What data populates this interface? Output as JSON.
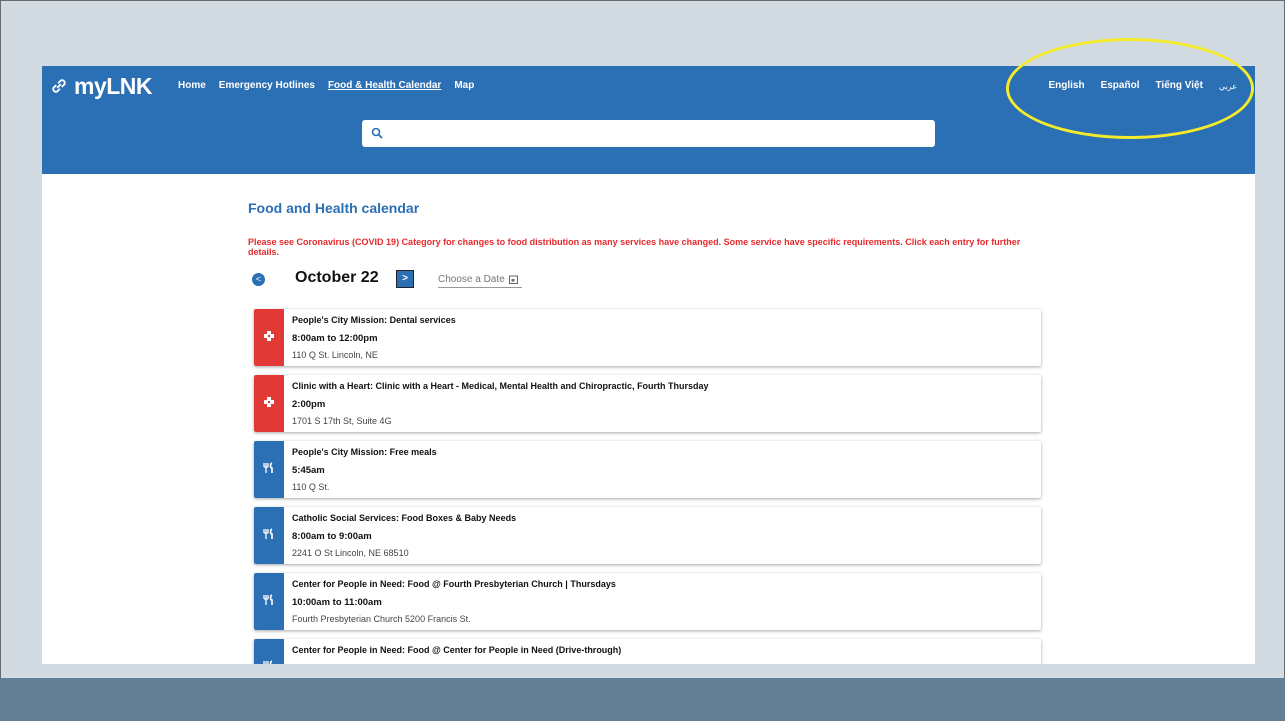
{
  "header": {
    "logo_text": "myLNK",
    "nav": [
      "Home",
      "Emergency Hotlines",
      "Food & Health Calendar",
      "Map"
    ],
    "languages": [
      "English",
      "Español",
      "Tiếng Việt",
      "عربي"
    ]
  },
  "search": {
    "placeholder": ""
  },
  "page": {
    "title": "Food and Health calendar",
    "notice": "Please see Coronavirus (COVID 19) Category for changes to food distribution as many services have changed. Some service have specific requirements. Click each entry for further details.",
    "date": "October 22",
    "choose_date": "Choose a Date",
    "prev_label": "<",
    "next_label": ">"
  },
  "events": [
    {
      "category": "health",
      "title": "People's City Mission: Dental services",
      "time": "8:00am to 12:00pm",
      "address": "110 Q St. Lincoln, NE"
    },
    {
      "category": "health",
      "title": "Clinic with a Heart: Clinic with a Heart - Medical, Mental Health and Chiropractic, Fourth Thursday",
      "time": "2:00pm",
      "address": "1701 S 17th St, Suite 4G"
    },
    {
      "category": "food",
      "title": "People's City Mission: Free meals",
      "time": "5:45am",
      "address": "110 Q St."
    },
    {
      "category": "food",
      "title": "Catholic Social Services: Food Boxes & Baby Needs",
      "time": "8:00am to 9:00am",
      "address": "2241 O St Lincoln, NE 68510"
    },
    {
      "category": "food",
      "title": "Center for People in Need: Food @ Fourth Presbyterian Church | Thursdays",
      "time": "10:00am to 11:00am",
      "address": "Fourth Presbyterian Church 5200 Francis St."
    },
    {
      "category": "food",
      "title": "Center for People in Need: Food @ Center for People in Need (Drive-through)",
      "time": "",
      "address": ""
    }
  ],
  "colors": {
    "brand": "#2b6fb5",
    "health": "#e13a36",
    "notice": "#e5292d",
    "highlight": "#f4ec2a"
  }
}
